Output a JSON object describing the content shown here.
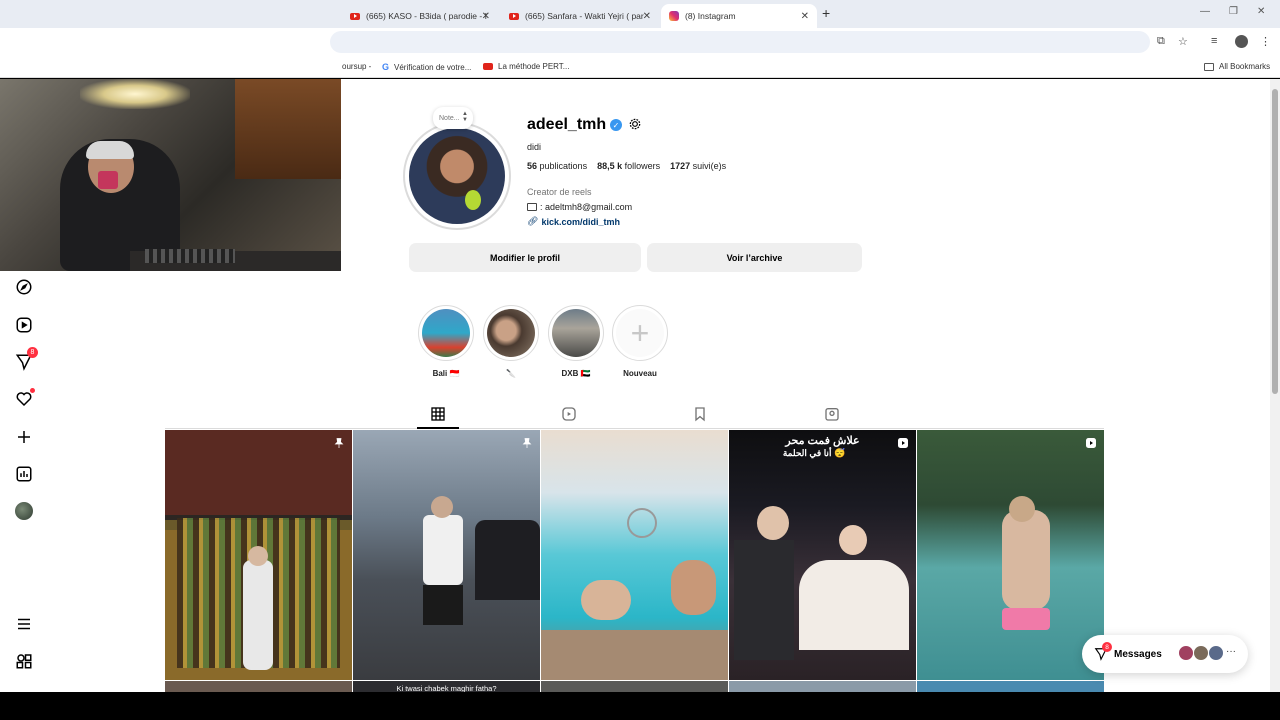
{
  "browser": {
    "tabs": [
      {
        "title": "(665) KASO - B3ida ( parodie - I",
        "type": "youtube"
      },
      {
        "title": "(665) Sanfara - Wakti Yejri ( par",
        "type": "youtube"
      },
      {
        "title": "(8) Instagram",
        "type": "instagram",
        "active": true
      }
    ],
    "bookmarks": [
      {
        "label": "oursup -",
        "type": "text"
      },
      {
        "label": "Vérification de votre...",
        "type": "google"
      },
      {
        "label": "La méthode PERT...",
        "type": "youtube"
      }
    ],
    "all_bookmarks": "All Bookmarks"
  },
  "sidebar": {
    "messages_badge": "8"
  },
  "profile": {
    "note_placeholder": "Note...",
    "username": "adeel_tmh",
    "display_name": "didi",
    "posts_count": "56",
    "posts_label": "publications",
    "followers_count": "88,5 k",
    "followers_label": "followers",
    "following_count": "1727",
    "following_label": "suivi(e)s",
    "category": "Creator de reels",
    "email": ": adeltmh8@gmail.com",
    "link": "kick.com/didi_tmh",
    "edit_button": "Modifier le profil",
    "archive_button": "Voir l’archive"
  },
  "highlights": [
    {
      "label": "Bali 🇮🇩"
    },
    {
      "label": "🔪"
    },
    {
      "label": "DXB 🇦🇪"
    },
    {
      "label": "Nouveau"
    }
  ],
  "posts": [
    {
      "pinned": true,
      "type": "photo"
    },
    {
      "pinned": true,
      "type": "photo",
      "caption_bottom": "Ki twasi chabek maghir fatha?"
    },
    {
      "pinned": false,
      "type": "photo"
    },
    {
      "pinned": false,
      "type": "reel",
      "overlay_text_line1": "علاش فمت محر",
      "overlay_text_line2": "أنا في الحلمة 😴"
    },
    {
      "pinned": false,
      "type": "reel"
    }
  ],
  "messages": {
    "label": "Messages",
    "badge": "8"
  }
}
